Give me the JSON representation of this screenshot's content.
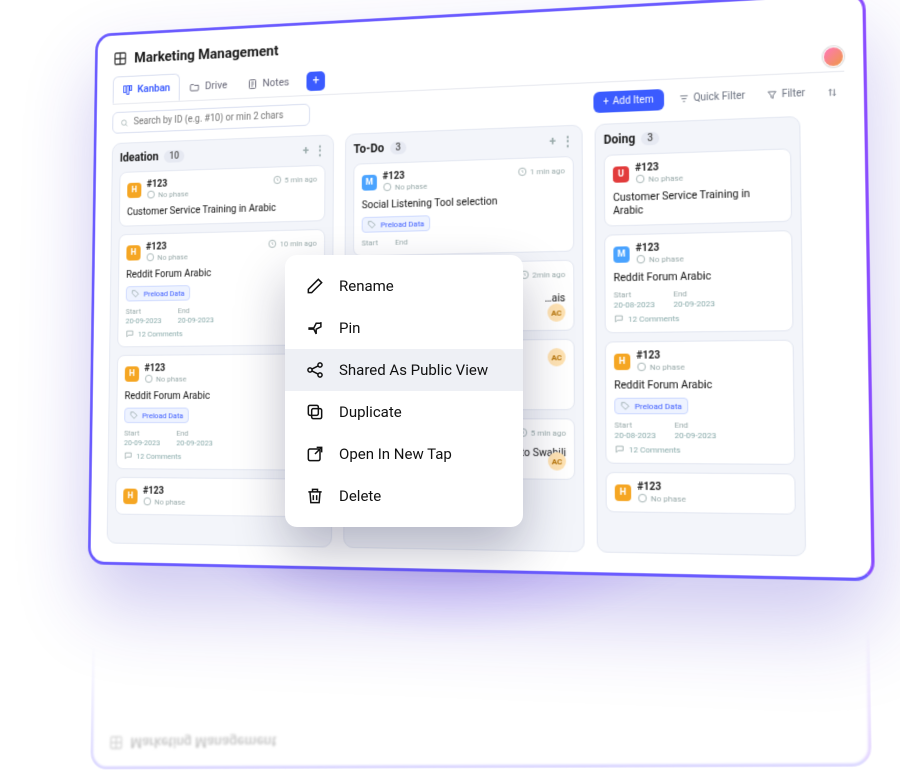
{
  "app": {
    "title": "Marketing Management"
  },
  "tabs": {
    "items": [
      {
        "label": "Kanban"
      },
      {
        "label": "Drive"
      },
      {
        "label": "Notes"
      }
    ]
  },
  "search": {
    "placeholder": "Search by ID (e.g. #10) or min 2 chars"
  },
  "toolbar": {
    "add": "Add Item",
    "quickfilter": "Quick Filter",
    "filter": "Filter"
  },
  "col": {
    "ideation": {
      "title": "Ideation",
      "count": "10"
    },
    "todo": {
      "title": "To-Do",
      "count": "3"
    },
    "doing": {
      "title": "Doing",
      "count": "3"
    }
  },
  "lbl": {
    "nophase": "No phase",
    "preload": "Preload Data",
    "start": "Start",
    "end": "End",
    "comments12": "12 Comments"
  },
  "card": {
    "id123": "#123",
    "ideation1": {
      "title": "Customer Service Training in Arabic",
      "ago": "5 min ago"
    },
    "ideation2": {
      "title": "Reddit Forum Arabic",
      "ago": "10 min ago",
      "d1": "20-09-2023",
      "d2": "20-09-2023"
    },
    "ideation3": {
      "title": "Reddit Forum Arabic",
      "d1": "20-09-2023",
      "d2": "20-09-2023"
    },
    "todo1": {
      "title": "Social Listening Tool selection",
      "ago": "1 min ago",
      "start": "Start",
      "end": "End"
    },
    "todo2": {
      "title": "…ais",
      "ago": "2min ago"
    },
    "todo3": {
      "title": "…nuals to Swahili",
      "ago": "5 min ago"
    },
    "doing1": {
      "title": "Customer Service Training in Arabic"
    },
    "doing2": {
      "title": "Reddit Forum Arabic",
      "d1": "20-08-2023",
      "d2": "20-09-2023"
    },
    "doing3": {
      "title": "Reddit Forum Arabic",
      "d1": "20-08-2023",
      "d2": "20-09-2023"
    }
  },
  "assignee": {
    "ac": "AC"
  },
  "ctx": {
    "rename": "Rename",
    "pin": "Pin",
    "shared": "Shared As Public View",
    "duplicate": "Duplicate",
    "open": "Open In New Tap",
    "delete": "Delete"
  }
}
